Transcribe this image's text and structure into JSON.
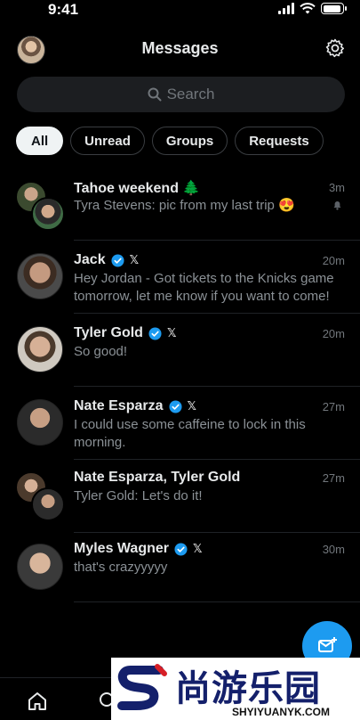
{
  "status_bar": {
    "time": "9:41",
    "battery_level": 0.95
  },
  "header": {
    "title": "Messages",
    "settings_icon": "gear-icon"
  },
  "search": {
    "placeholder": "Search",
    "icon": "search-icon"
  },
  "filters": [
    {
      "label": "All",
      "active": true
    },
    {
      "label": "Unread",
      "active": false
    },
    {
      "label": "Groups",
      "active": false
    },
    {
      "label": "Requests",
      "active": false
    }
  ],
  "conversations": [
    {
      "name": "Tahoe weekend 🌲",
      "time": "3m",
      "preview": "Tyra Stevens: pic from my last trip 😍",
      "muted": true,
      "group": true
    },
    {
      "name": "Jack",
      "time": "20m",
      "preview": "Hey Jordan - Got tickets to the Knicks game tomorrow, let me know if you want to come!",
      "verified": true,
      "x_badge": "𝕏"
    },
    {
      "name": "Tyler Gold",
      "time": "20m",
      "preview": "So good!",
      "verified": true,
      "x_badge": "𝕏"
    },
    {
      "name": "Nate Esparza",
      "time": "27m",
      "preview": "I could use some caffeine to lock in this morning.",
      "verified": true,
      "x_badge": "𝕏"
    },
    {
      "name": "Nate Esparza, Tyler Gold",
      "time": "27m",
      "preview": "Tyler Gold: Let's do it!",
      "group": true
    },
    {
      "name": "Myles Wagner",
      "time": "30m",
      "preview": "that's crazyyyyy",
      "verified": true,
      "x_badge": "𝕏"
    }
  ],
  "fab": {
    "icon": "new-message-icon"
  },
  "bottom_nav": [
    {
      "icon": "home-icon"
    },
    {
      "icon": "search-icon"
    }
  ],
  "watermark": {
    "text": "尚游乐园",
    "url": "SHYIYUANYK.COM"
  },
  "colors": {
    "accent": "#1d9bf0",
    "background": "#000000",
    "secondary_text": "#71767b"
  }
}
